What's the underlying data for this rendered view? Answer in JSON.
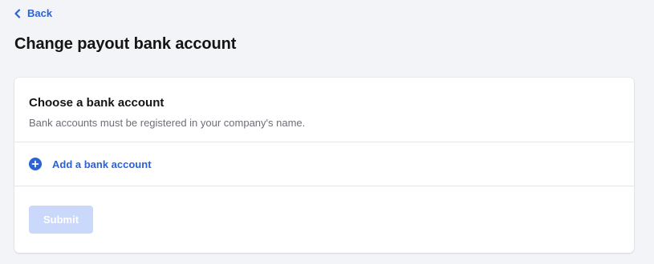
{
  "nav": {
    "back_label": "Back",
    "back_icon": "chevron-left-icon"
  },
  "page": {
    "title": "Change payout bank account"
  },
  "bank_section": {
    "title": "Choose a bank account",
    "subtitle": "Bank accounts must be registered in your company's name.",
    "add_label": "Add a bank account",
    "add_icon": "plus-circle-icon"
  },
  "form": {
    "submit_label": "Submit",
    "submit_disabled": true
  },
  "colors": {
    "accent": "#2b62d6",
    "background": "#f3f4f7",
    "card": "#ffffff",
    "submit_disabled_bg": "#c9d8fb",
    "muted_text": "#6b6f78"
  }
}
